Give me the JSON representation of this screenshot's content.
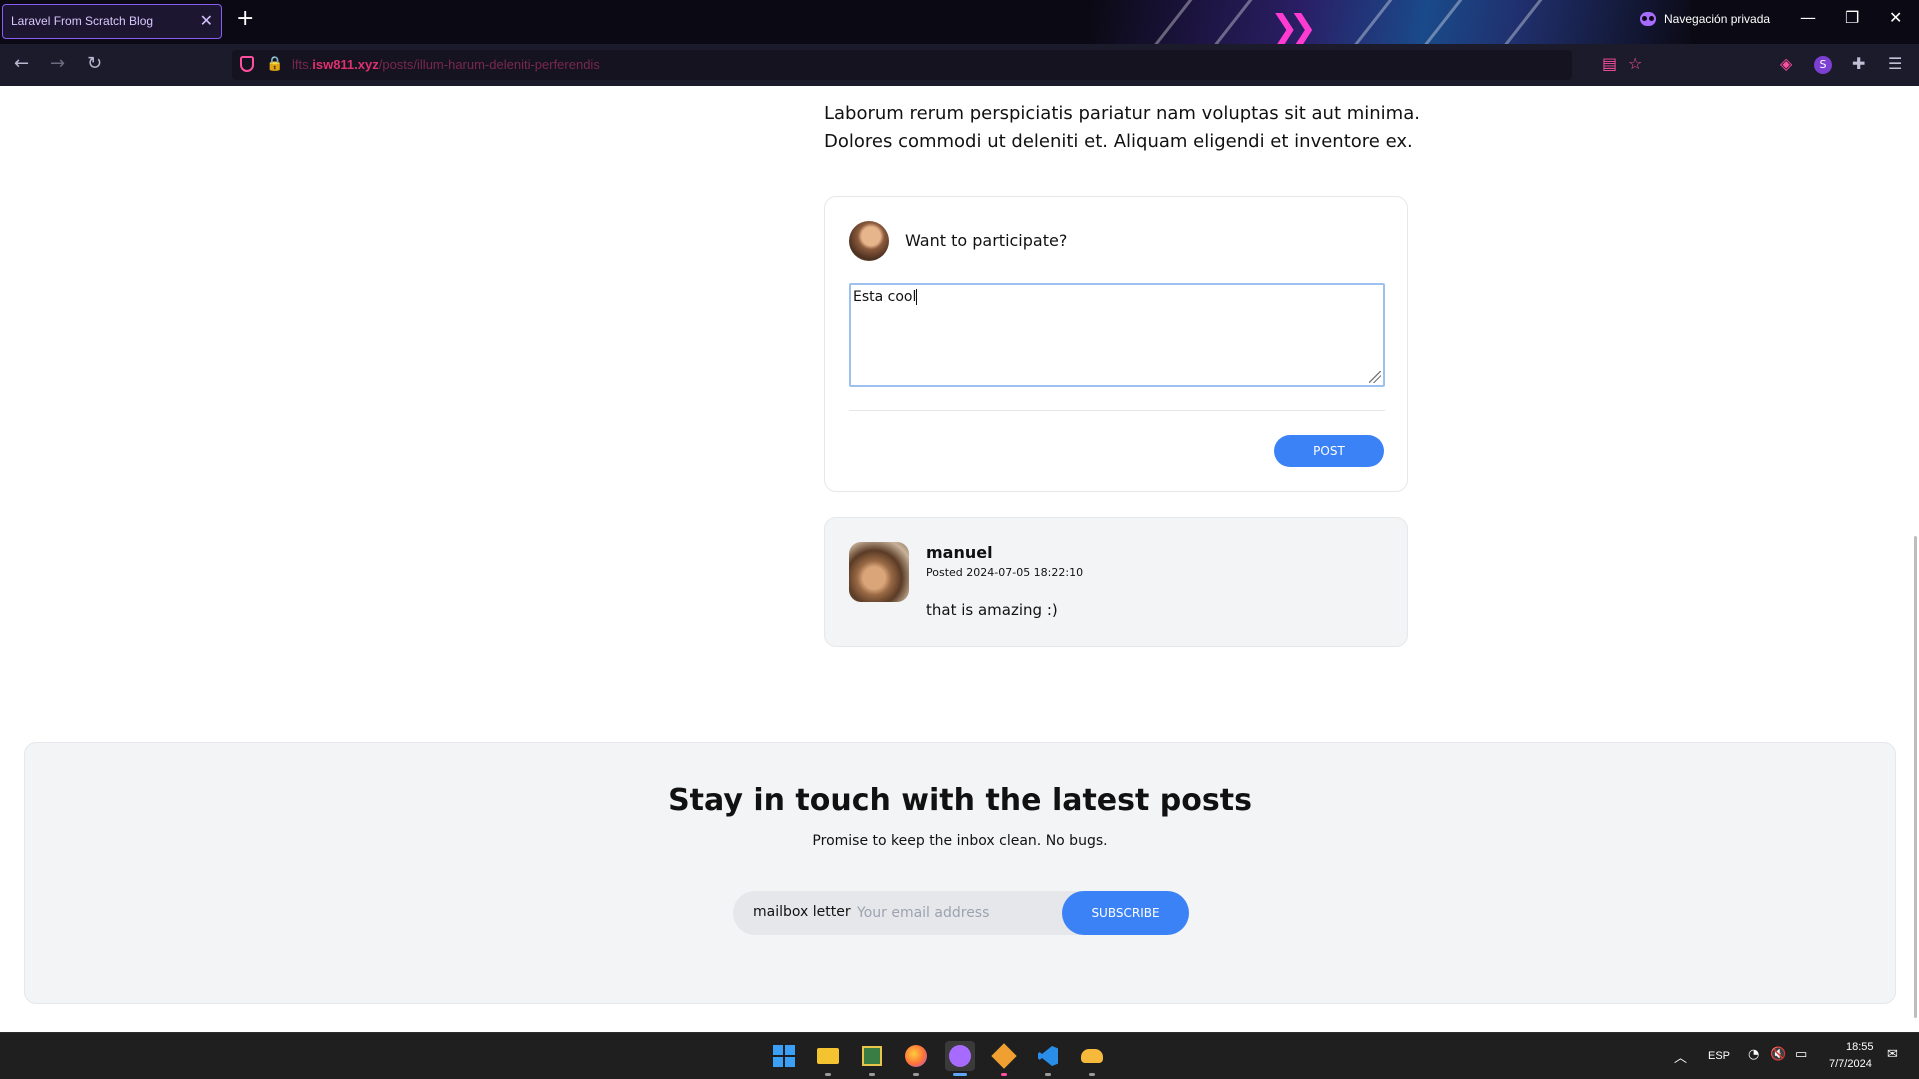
{
  "browser": {
    "tab_title": "Laravel From Scratch Blog",
    "tab_close": "✕",
    "new_tab": "+",
    "private_label": "Navegación privada",
    "url_prefix": "lfts.",
    "url_host": "isw811.xyz",
    "url_path": "/posts/illum-harum-deleniti-perferendis",
    "profile_initial": "S"
  },
  "post": {
    "body": "Laborum rerum perspiciatis pariatur nam voluptas sit aut minima. Dolores commodi ut deleniti et. Aliquam eligendi et inventore ex."
  },
  "comment_form": {
    "prompt": "Want to participate?",
    "textarea_value": "Esta cool",
    "submit_label": "Post"
  },
  "comments": [
    {
      "author": "manuel",
      "meta": "Posted 2024-07-05 18:22:10",
      "body": "that is amazing :)"
    }
  ],
  "newsletter": {
    "title": "Stay in touch with the latest posts",
    "subtitle": "Promise to keep the inbox clean. No bugs.",
    "field_label": "mailbox letter",
    "email_placeholder": "Your email address",
    "submit_label": "Subscribe"
  },
  "taskbar": {
    "language": "ESP",
    "time": "18:55",
    "date": "7/7/2024"
  },
  "colors": {
    "accent": "#3b82f6",
    "panel": "#f3f4f6",
    "url_accent": "#e0306f"
  }
}
